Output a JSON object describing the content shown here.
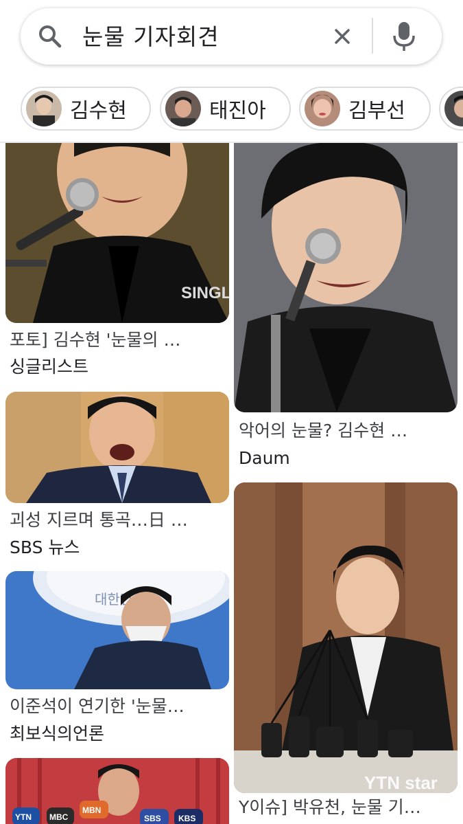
{
  "search": {
    "query": "눈물 기자회견"
  },
  "chips": [
    {
      "label": "김수현"
    },
    {
      "label": "태진아"
    },
    {
      "label": "김부선"
    }
  ],
  "results": {
    "left": [
      {
        "caption": "포토] 김수현 '눈물의 …",
        "source": "싱글리스트",
        "watermark": "SINGLE LIST"
      },
      {
        "caption": "괴성 지르며 통곡…日 …",
        "source": "SBS 뉴스"
      },
      {
        "caption": "이준석이 연기한 '눈물…",
        "source": "최보식의언론",
        "sign_text": "대한민국"
      },
      {
        "mic_labels": [
          "YTN",
          "MBC",
          "MBN",
          "SBS",
          "KBS"
        ]
      }
    ],
    "right": [
      {
        "caption": "악어의 눈물? 김수현 …",
        "source": "Daum"
      },
      {
        "caption": "Y이슈] 박유천, 눈물 기…",
        "watermark": "YTN star"
      }
    ]
  }
}
